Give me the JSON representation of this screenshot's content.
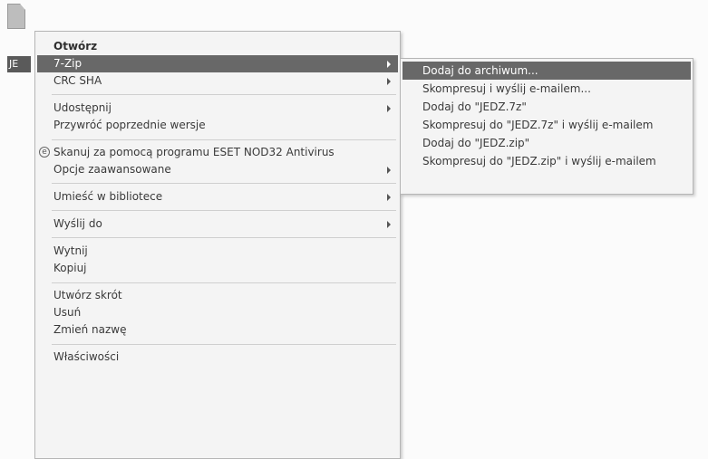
{
  "desktop": {
    "file_label": "JE"
  },
  "menu": {
    "items": [
      {
        "label": "Otwórz"
      },
      {
        "label": "7-Zip"
      },
      {
        "label": "CRC SHA"
      },
      {
        "label": "Udostępnij"
      },
      {
        "label": "Przywróć poprzednie wersje"
      },
      {
        "label": "Skanuj za pomocą programu ESET NOD32 Antivirus",
        "icon": "eset-icon"
      },
      {
        "label": "Opcje zaawansowane"
      },
      {
        "label": "Umieść w bibliotece"
      },
      {
        "label": "Wyślij do"
      },
      {
        "label": "Wytnij"
      },
      {
        "label": "Kopiuj"
      },
      {
        "label": "Utwórz skrót"
      },
      {
        "label": "Usuń"
      },
      {
        "label": "Zmień nazwę"
      },
      {
        "label": "Właściwości"
      }
    ],
    "eset_glyph": "e"
  },
  "submenu": {
    "items": [
      {
        "label": "Dodaj do archiwum..."
      },
      {
        "label": "Skompresuj i wyślij e-mailem..."
      },
      {
        "label": "Dodaj do \"JEDZ.7z\""
      },
      {
        "label": "Skompresuj do \"JEDZ.7z\" i wyślij e-mailem"
      },
      {
        "label": "Dodaj do \"JEDZ.zip\""
      },
      {
        "label": "Skompresuj do \"JEDZ.zip\" i wyślij e-mailem"
      }
    ]
  },
  "colors": {
    "highlight": "#686868",
    "menu_background": "#f4f4f4"
  }
}
